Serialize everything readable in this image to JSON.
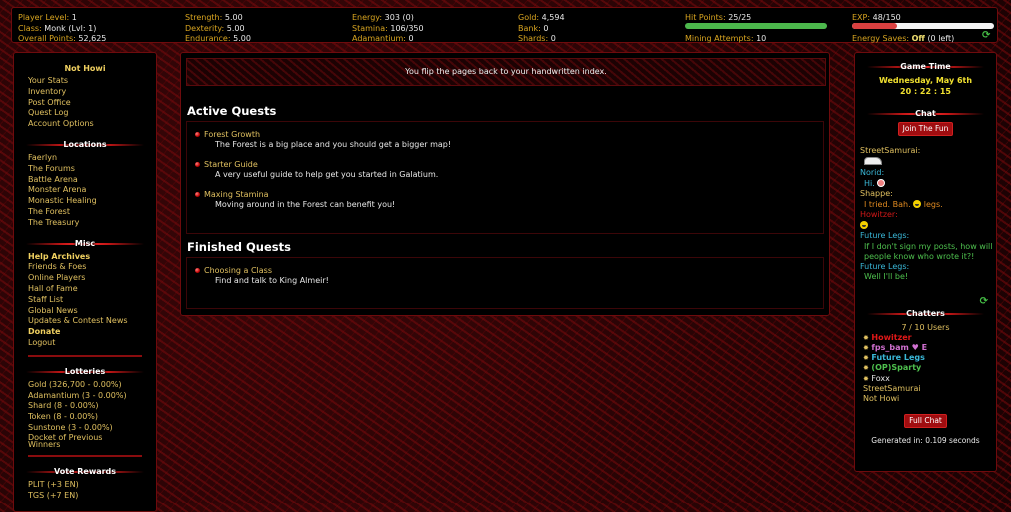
{
  "stats": {
    "col1": [
      {
        "label": "Player Level:",
        "value": "1"
      },
      {
        "label": "Class:",
        "value": "Monk (Lvl: 1)"
      },
      {
        "label": "Overall Points:",
        "value": "52,625"
      }
    ],
    "col2": [
      {
        "label": "Strength:",
        "value": "5.00"
      },
      {
        "label": "Dexterity:",
        "value": "5.00"
      },
      {
        "label": "Endurance:",
        "value": "5.00"
      }
    ],
    "col3": [
      {
        "label": "Energy:",
        "value": "303 (0)"
      },
      {
        "label": "Stamina:",
        "value": "106/350"
      },
      {
        "label": "Adamantium:",
        "value": "0"
      }
    ],
    "col4": [
      {
        "label": "Gold:",
        "value": "4,594"
      },
      {
        "label": "Bank:",
        "value": "0"
      },
      {
        "label": "Shards:",
        "value": "0"
      }
    ],
    "hit_points": {
      "label": "Hit Points:",
      "value": "25/25",
      "fraction": 1.0,
      "color": "#4cb84c"
    },
    "mining": {
      "label": "Mining Attempts:",
      "value": "10"
    },
    "exp": {
      "label": "EXP:",
      "value": "48/150",
      "fraction": 0.32,
      "color": "#d94040"
    },
    "energy_saves": {
      "label": "Energy Saves:",
      "value": "Off",
      "extra": "(0 left)"
    },
    "refresh_icon": "refresh-icon"
  },
  "left": {
    "user": "Not Howi",
    "user_links": [
      "Your Stats",
      "Inventory",
      "Post Office",
      "Quest Log",
      "Account Options"
    ],
    "locations_title": "Locations",
    "locations": [
      "Faerlyn",
      "The Forums",
      "Battle Arena",
      "Monster Arena",
      "Monastic Healing",
      "The Forest",
      "The Treasury"
    ],
    "misc_title": "Misc",
    "misc": [
      {
        "label": "Help Archives",
        "bold": true
      },
      {
        "label": "Friends & Foes",
        "bold": false
      },
      {
        "label": "Online Players",
        "bold": false
      },
      {
        "label": "Hall of Fame",
        "bold": false
      },
      {
        "label": "Staff List",
        "bold": false
      },
      {
        "label": "Global News",
        "bold": false
      },
      {
        "label": "Updates & Contest News",
        "bold": false
      },
      {
        "label": "Donate",
        "bold": true
      },
      {
        "label": "Logout",
        "bold": false
      }
    ],
    "lotteries_title": "Lotteries",
    "lotteries": [
      "Gold (326,700 - 0.00%)",
      "Adamantium (3 - 0.00%)",
      "Shard (8 - 0.00%)",
      "Token (8 - 0.00%)",
      "Sunstone (3 - 0.00%)",
      "Docket of Previous Winners"
    ],
    "vote_title": "Vote Rewards",
    "vote": [
      "PLIT (+3 EN)",
      "TGS (+7 EN)"
    ]
  },
  "main": {
    "message": "You flip the pages back to your handwritten index.",
    "active_title": "Active Quests",
    "active": [
      {
        "title": "Forest Growth",
        "desc": "The Forest is a big place and you should get a bigger map!"
      },
      {
        "title": "Starter Guide",
        "desc": "A very useful guide to help get you started in Galatium."
      },
      {
        "title": "Maxing Stamina",
        "desc": "Moving around in the Forest can benefit you!"
      }
    ],
    "finished_title": "Finished Quests",
    "finished": [
      {
        "title": "Choosing a Class",
        "desc": "Find and talk to King Almeir!"
      }
    ]
  },
  "right": {
    "game_time_title": "Game Time",
    "date": "Wednesday, May 6th",
    "time": "20 : 22 : 15",
    "chat_title": "Chat",
    "join_button": "Join The Fun",
    "chat": [
      {
        "name": "StreetSamurai:",
        "name_color": "#e0c060",
        "msg": "",
        "msg_color": "#e0c060",
        "icon": "image-icon"
      },
      {
        "name": "Norid:",
        "name_color": "#3ab8d8",
        "msg": "Hi.",
        "msg_color": "#3ab8d8",
        "icon": "pig-emoticon-icon"
      },
      {
        "name": "Shappe:",
        "name_color": "#e0c060",
        "msg": "I tried. Bah.",
        "msg2": "legs.",
        "msg_color": "#e08a20",
        "icon": "smiley-icon"
      },
      {
        "name": "Howitzer:",
        "name_color": "#d01818",
        "msg": "",
        "msg_color": "#d01818",
        "icon": "smiley-icon"
      },
      {
        "name": "Future Legs:",
        "name_color": "#3ab8d8",
        "msg": "If I don't sign my posts, how will people know who wrote it?!",
        "msg_color": "#4ec04e",
        "icon": ""
      },
      {
        "name": "Future Legs:",
        "name_color": "#3ab8d8",
        "msg": "Well I'll be!",
        "msg_color": "#4ec04e",
        "icon": ""
      }
    ],
    "chatters_title": "Chatters",
    "chatters_count": "7 / 10 Users",
    "chatters": [
      {
        "name": "Howitzer",
        "color": "#e01818",
        "star": true,
        "bold": true
      },
      {
        "name": "fps_bam ♥ E",
        "color": "#d070d0",
        "star": true,
        "bold": true
      },
      {
        "name": "Future Legs",
        "color": "#3ab8d8",
        "star": true,
        "bold": true
      },
      {
        "name": "(OP)Sparty",
        "color": "#4ec04e",
        "star": true,
        "bold": true
      },
      {
        "name": "Foxx",
        "color": "#e8e8e8",
        "star": true,
        "bold": false
      },
      {
        "name": "StreetSamurai",
        "color": "#e0c060",
        "star": false,
        "bold": false
      },
      {
        "name": "Not Howi",
        "color": "#e0c060",
        "star": false,
        "bold": false
      }
    ],
    "full_chat_button": "Full Chat",
    "generated": "Generated in: 0.109 seconds"
  }
}
